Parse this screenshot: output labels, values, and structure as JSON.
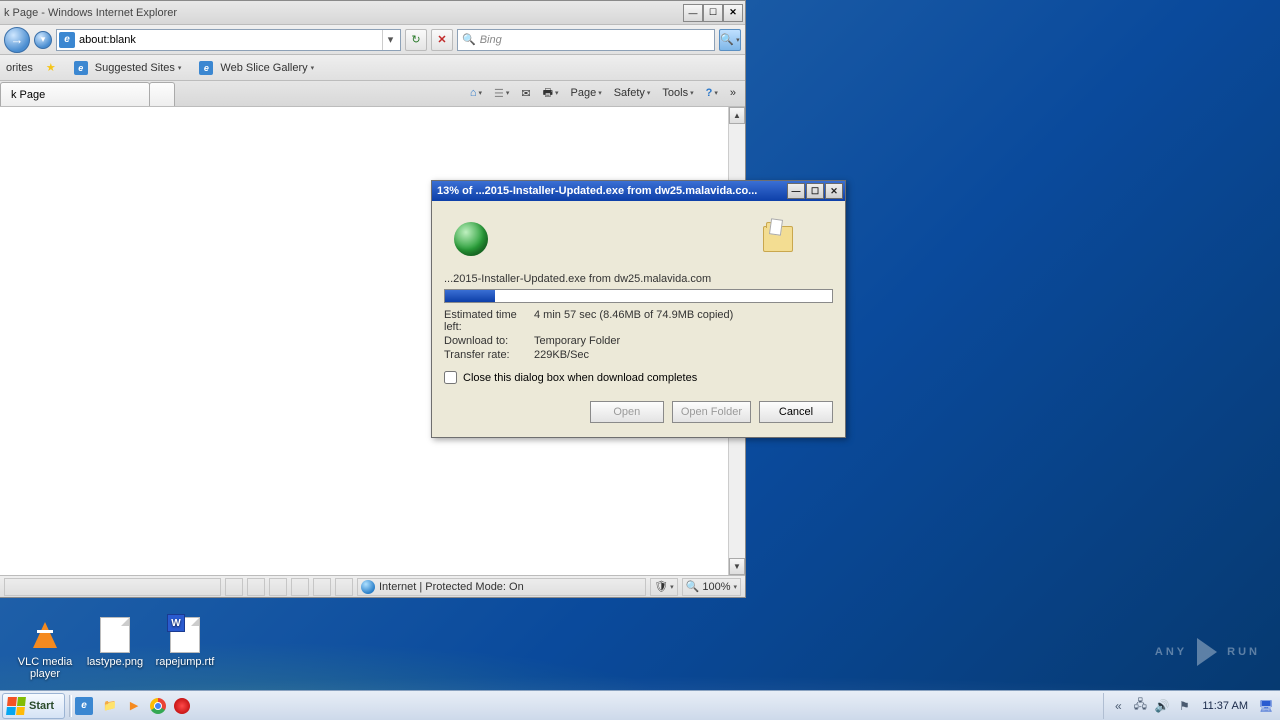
{
  "ie": {
    "title": "k Page - Windows Internet Explorer",
    "address": "about:blank",
    "search_placeholder": "Bing",
    "favbar": {
      "label": "orites",
      "suggested": "Suggested Sites",
      "webslice": "Web Slice Gallery"
    },
    "tab": "k Page",
    "cmd": {
      "page": "Page",
      "safety": "Safety",
      "tools": "Tools"
    },
    "status": {
      "zone": "Internet | Protected Mode: On",
      "zoom": "100%"
    }
  },
  "download": {
    "title": "13% of ...2015-Installer-Updated.exe from dw25.malavida.co...",
    "file_line": "...2015-Installer-Updated.exe from dw25.malavida.com",
    "progress_percent": 13,
    "labels": {
      "eta": "Estimated time left:",
      "dest": "Download to:",
      "rate": "Transfer rate:"
    },
    "eta": "4 min 57 sec (8.46MB of 74.9MB copied)",
    "dest": "Temporary Folder",
    "rate": "229KB/Sec",
    "close_when_done": "Close this dialog box when download completes",
    "btn_open": "Open",
    "btn_open_folder": "Open Folder",
    "btn_cancel": "Cancel"
  },
  "desktop": {
    "icons": [
      {
        "label": "VLC media player"
      },
      {
        "label": "lastype.png"
      },
      {
        "label": "rapejump.rtf"
      }
    ]
  },
  "watermark": {
    "text1": "ANY",
    "text2": "RUN"
  },
  "taskbar": {
    "start": "Start",
    "clock": "11:37 AM"
  }
}
